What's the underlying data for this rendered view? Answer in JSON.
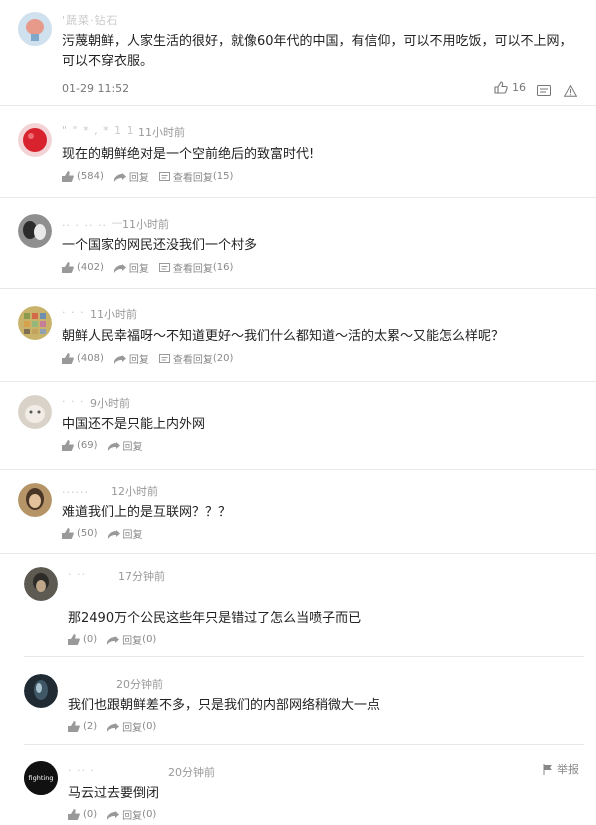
{
  "comments": [
    {
      "username": "'蔬菜·钻石",
      "text": "污蔑朝鲜，人家生活的很好，就像60年代的中国，有信仰，可以不用吃饭，可以不上网，可以不穿衣服。",
      "time": "01-29 11:52",
      "likes": "16"
    },
    {
      "username": "\" \" * , * 1 1",
      "time": "11小时前",
      "text": "现在的朝鲜绝对是一个空前绝后的致富时代!",
      "likes": "(584)",
      "reply": "回复",
      "view_replies": "查看回复",
      "reply_count": "(15)"
    },
    {
      "username": ".. . .. .. —",
      "time": "11小时前",
      "text": "一个国家的网民还没我们一个村多",
      "likes": "(402)",
      "reply": "回复",
      "view_replies": "查看回复",
      "reply_count": "(16)"
    },
    {
      "username": "· · ·",
      "time": "11小时前",
      "text": "朝鲜人民幸福呀～不知道更好～我们什么都知道～活的太累～又能怎么样呢？",
      "likes": "(408)",
      "reply": "回复",
      "view_replies": "查看回复",
      "reply_count": "(20)"
    },
    {
      "username": "· · ·",
      "time": "9小时前",
      "text": "中国还不是只能上内外网",
      "likes": "(69)",
      "reply": "回复"
    },
    {
      "username": "......",
      "time": "12小时前",
      "text": "难道我们上的是互联网？？？",
      "likes": "(50)",
      "reply": "回复"
    },
    {
      "username": "·  ··",
      "time": "17分钟前",
      "text": "那2490万个公民这些年只是错过了怎么当喷子而已",
      "likes": "(0)",
      "reply": "回复",
      "reply_count": "(0)"
    },
    {
      "username": "",
      "time": "20分钟前",
      "text": "我们也跟朝鲜差不多，只是我们的内部网络稍微大一点",
      "likes": "(2)",
      "reply": "回复",
      "reply_count": "(0)"
    },
    {
      "username": "·  ·· ·",
      "time": "20分钟前",
      "text": "马云过去要倒闭",
      "likes": "(0)",
      "reply": "回复",
      "reply_count": "(0)",
      "report": "举报",
      "avatar_text": "fighting"
    }
  ]
}
